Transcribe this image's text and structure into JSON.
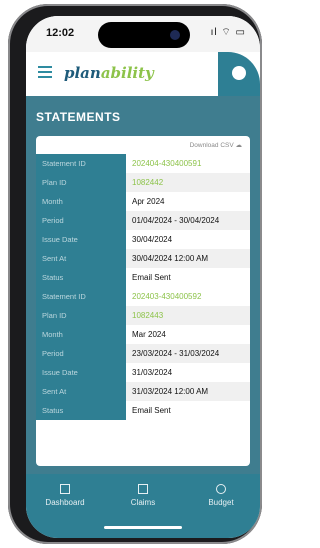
{
  "status_bar": {
    "time": "12:02",
    "icons": "ıl ⌔ ▭"
  },
  "app": {
    "logo_part1": "plan",
    "logo_part2": "ability"
  },
  "page": {
    "title": "STATEMENTS"
  },
  "card": {
    "download_label": "Download CSV"
  },
  "statements": [
    {
      "rows": [
        {
          "label": "Statement ID",
          "value": "202404-430400591",
          "link": true
        },
        {
          "label": "Plan ID",
          "value": "1082442",
          "link": true
        },
        {
          "label": "Month",
          "value": "Apr 2024"
        },
        {
          "label": "Period",
          "value": "01/04/2024 - 30/04/2024"
        },
        {
          "label": "Issue Date",
          "value": "30/04/2024"
        },
        {
          "label": "Sent At",
          "value": "30/04/2024 12:00 AM"
        },
        {
          "label": "Status",
          "value": "Email Sent"
        }
      ]
    },
    {
      "rows": [
        {
          "label": "Statement ID",
          "value": "202403-430400592",
          "link": true
        },
        {
          "label": "Plan ID",
          "value": "1082443",
          "link": true
        },
        {
          "label": "Month",
          "value": "Mar 2024"
        },
        {
          "label": "Period",
          "value": "23/03/2024 - 31/03/2024"
        },
        {
          "label": "Issue Date",
          "value": "31/03/2024"
        },
        {
          "label": "Sent At",
          "value": "31/03/2024 12:00 AM"
        },
        {
          "label": "Status",
          "value": "Email Sent"
        }
      ]
    }
  ],
  "nav": [
    {
      "label": "Dashboard",
      "icon": "dashboard-icon"
    },
    {
      "label": "Claims",
      "icon": "claims-icon"
    },
    {
      "label": "Budget",
      "icon": "budget-icon"
    }
  ],
  "colors": {
    "accent": "#2f7f93",
    "link": "#8dc34a",
    "background": "#3f7d8f"
  }
}
